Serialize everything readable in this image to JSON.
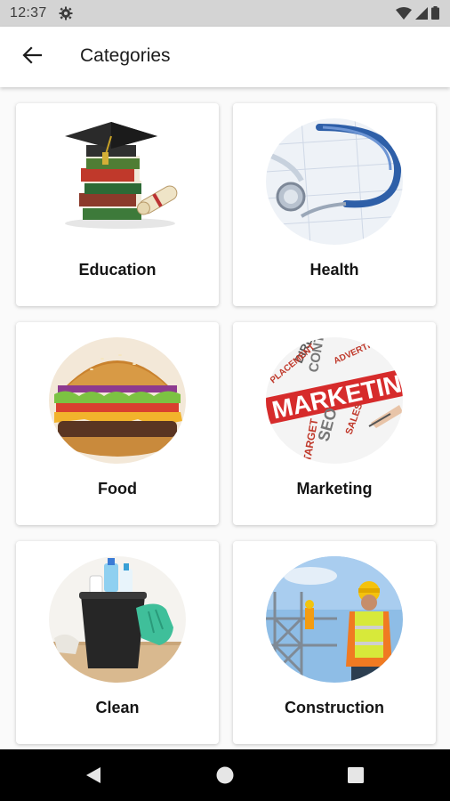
{
  "status_bar": {
    "time": "12:37"
  },
  "app_bar": {
    "title": "Categories"
  },
  "categories": [
    {
      "label": "Education"
    },
    {
      "label": "Health"
    },
    {
      "label": "Food"
    },
    {
      "label": "Marketing"
    },
    {
      "label": "Clean"
    },
    {
      "label": "Construction"
    }
  ],
  "marketing_image_text": {
    "main": "MARKETIN",
    "words": [
      "DIRECT",
      "CONTENT",
      "ADVERTISING",
      "PLACEMENT",
      "SEO",
      "SALES",
      "TARGET"
    ]
  },
  "colors": {
    "status_bar_bg": "#d4d4d4",
    "app_bar_bg": "#ffffff",
    "page_bg": "#fafafa",
    "nav_bar_bg": "#000000"
  }
}
